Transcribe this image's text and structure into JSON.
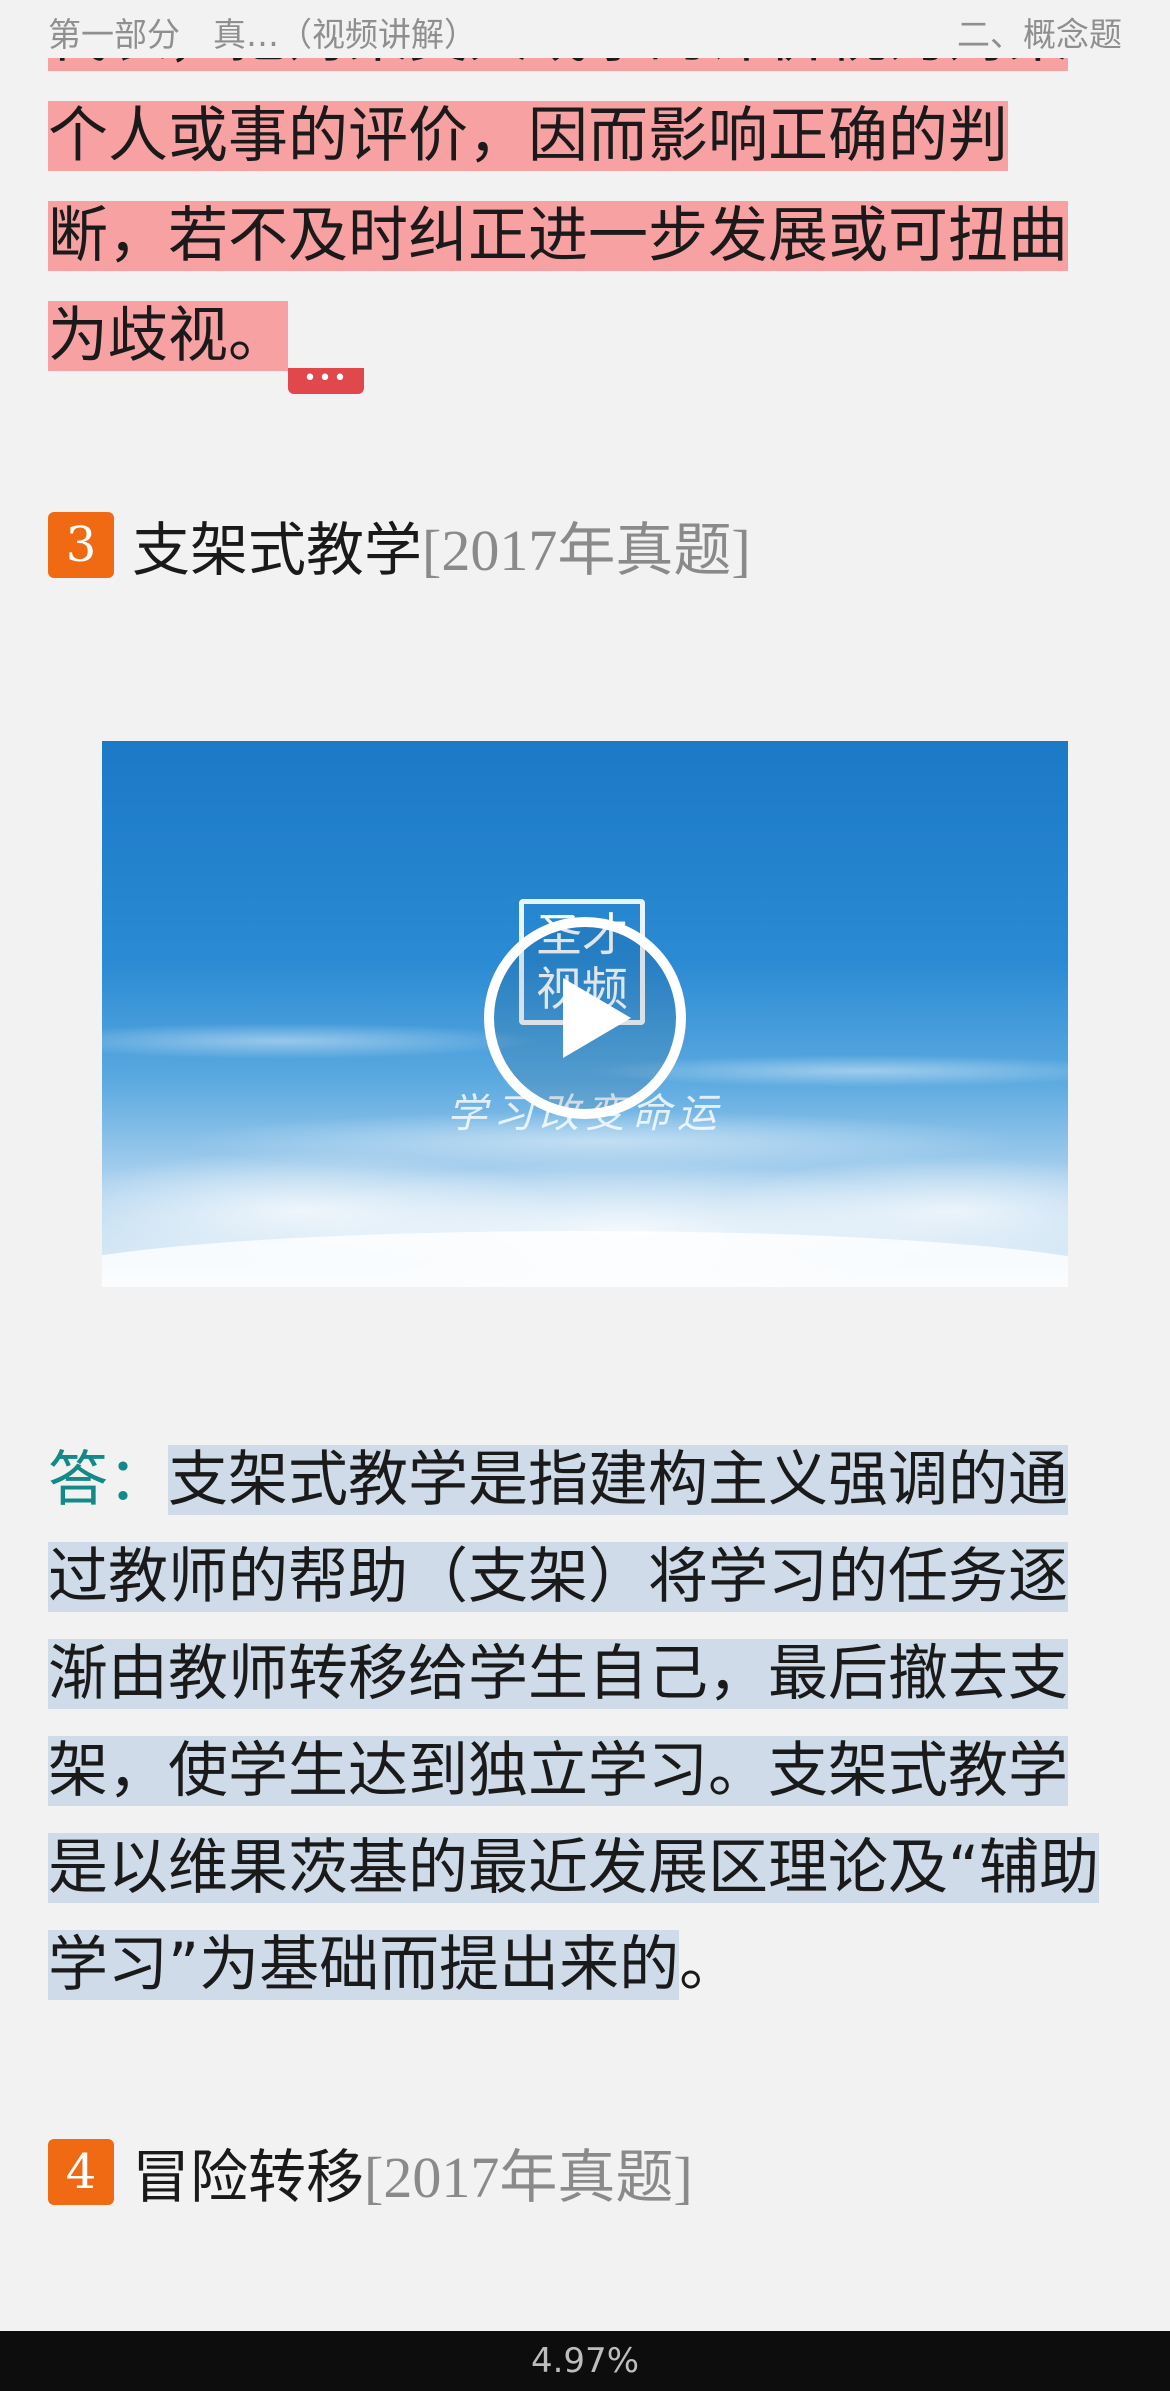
{
  "header": {
    "left": "第一部分　真…（视频讲解）",
    "right": "二、概念题"
  },
  "paragraph1": {
    "lines": [
      "代表，把对某类人或事的评价视为对某",
      "个人或事的评价，因而影响正确的判",
      "断，若不及时纠正进一步发展或可扭曲",
      "为歧视。"
    ],
    "more_label": "•••"
  },
  "section3": {
    "number": "3",
    "title": "支架式教学",
    "tag": "[2017年真题]"
  },
  "video": {
    "logo_line1": "圣才",
    "logo_line2": "视频",
    "slogan": "学习改变命运",
    "play_icon": "play-icon"
  },
  "answer": {
    "label": "答：",
    "lines": [
      "支架式教学是指建构主义强调的通",
      "过教师的帮助（支架）将学习的任务逐",
      "渐由教师转移给学生自己，最后撤去支",
      "架，使学生达到独立学习。支架式教学",
      "是以维果茨基的最近发展区理论及“辅助",
      "学习”为基础而提出来的"
    ],
    "end_mark": "。"
  },
  "section4": {
    "number": "4",
    "title": "冒险转移",
    "tag": "[2017年真题]"
  },
  "status": {
    "progress": "4.97%"
  },
  "colors": {
    "highlight_pink": "#f8a1a3",
    "highlight_blue": "#cfdbe8",
    "badge_orange": "#f06a14",
    "answer_label": "#138a87"
  }
}
